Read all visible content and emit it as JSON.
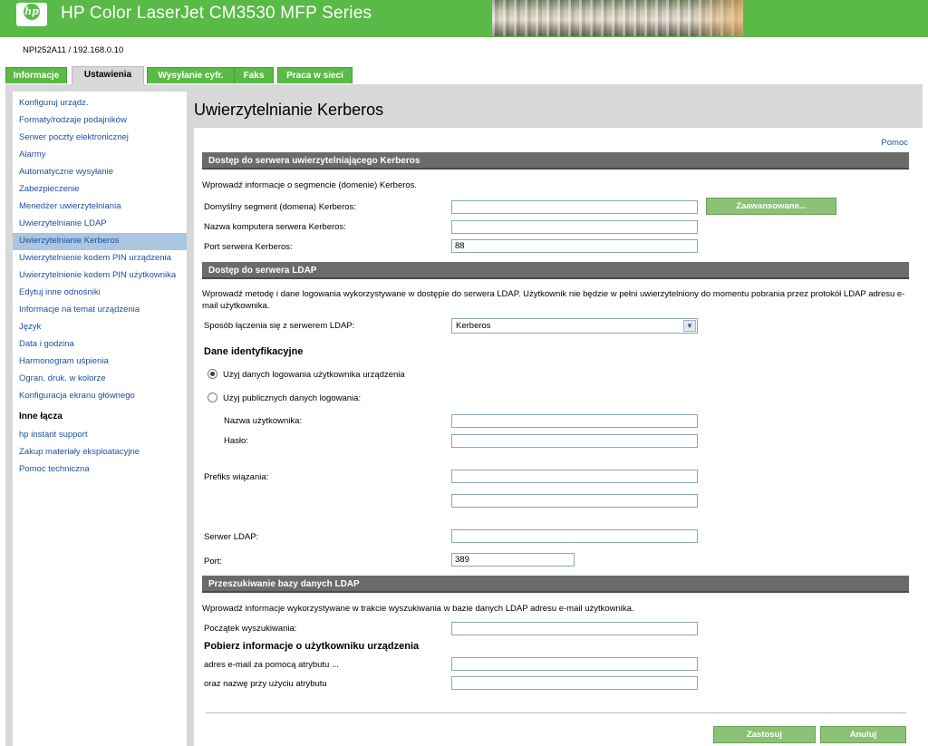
{
  "header": {
    "logo_text": "hp",
    "title": "HP Color LaserJet CM3530 MFP Series",
    "device_id": "NPI252A11 / 192.168.0.10"
  },
  "tabs": [
    {
      "label": "Informacje"
    },
    {
      "label": "Ustawienia"
    },
    {
      "label": "Wysyłanie cyfr."
    },
    {
      "label": "Faks"
    },
    {
      "label": "Praca w sieci"
    }
  ],
  "sidebar": {
    "items": [
      {
        "label": "Konfiguruj urządz."
      },
      {
        "label": "Formaty/rodzaje podajników"
      },
      {
        "label": "Serwer poczty elektronicznej"
      },
      {
        "label": "Alarmy"
      },
      {
        "label": "Automatyczne wysyłanie"
      },
      {
        "label": "Zabezpieczenie"
      },
      {
        "label": "Menedżer uwierzytelniania"
      },
      {
        "label": "Uwierzytelnianie LDAP"
      },
      {
        "label": "Uwierzytelnianie Kerberos"
      },
      {
        "label": "Uwierzytelnienie kodem PIN urządzenia"
      },
      {
        "label": "Uwierzytelnienie kodem PIN użytkownika"
      },
      {
        "label": "Edytuj inne odnośniki"
      },
      {
        "label": "Informacje na temat urządzenia"
      },
      {
        "label": "Język"
      },
      {
        "label": "Data i godzina"
      },
      {
        "label": "Harmonogram uśpienia"
      },
      {
        "label": "Ogran. druk. w kolorze"
      },
      {
        "label": "Konfiguracja ekranu głównego"
      }
    ],
    "other_links_heading": "Inne łącza",
    "other_links": [
      {
        "label": "hp instant support"
      },
      {
        "label": "Zakup materiały eksploatacyjne"
      },
      {
        "label": "Pomoc techniczna"
      }
    ]
  },
  "page": {
    "title": "Uwierzytelnianie Kerberos",
    "help_link": "Pomoc"
  },
  "kerberos": {
    "heading": "Dostęp do serwera uwierzytelniającego Kerberos",
    "intro": "Wprowadź informacje o segmencie (domenie) Kerberos.",
    "realm_label": "Domyślny segment (domena) Kerberos:",
    "realm_value": "",
    "advanced_button": "Zaawansowane...",
    "server_label": "Nazwa komputera serwera Kerberos:",
    "server_value": "",
    "port_label": "Port serwera Kerberos:",
    "port_value": "88"
  },
  "ldap": {
    "heading": "Dostęp do serwera LDAP",
    "intro": "Wprowadź metodę i dane logowania wykorzystywane w dostępie do serwera LDAP. Użytkownik nie będzie w pełni uwierzytelniony do momentu pobrania przez protokół LDAP adresu e-mail użytkownika.",
    "method_label": "Sposób łączenia się z serwerem LDAP:",
    "method_value": "Kerberos",
    "credentials_heading": "Dane identyfikacyjne",
    "radio_device_user": "Użyj danych logowania użytkownika urządzenia",
    "radio_public": "Użyj publicznych danych logowania:",
    "username_label": "Nazwa użytkownika:",
    "password_label": "Hasło:",
    "bind_prefix_label": "Prefiks wiązania:",
    "server_label": "Serwer LDAP:",
    "port_label": "Port:",
    "port_value": "389"
  },
  "search": {
    "heading": "Przeszukiwanie bazy danych LDAP",
    "intro": "Wprowadź informacje wykorzystywane w trakcie wyszukiwania w bazie danych LDAP adresu e-mail użytkownika.",
    "start_label": "Początek wyszukiwania:",
    "retrieve_heading": "Pobierz informacje o użytkowniku urządzenia",
    "email_attr_label": "adres e-mail za pomocą atrybutu ...",
    "name_attr_label": "oraz nazwę przy użyciu atrybutu"
  },
  "footer": {
    "apply": "Zastosuj",
    "cancel": "Anuluj"
  },
  "colors": {
    "brand_green": "#5aba47",
    "link_blue": "#1f4fa0",
    "section_bar": "#6b6b6b",
    "nav_selected": "#aac6e0"
  }
}
